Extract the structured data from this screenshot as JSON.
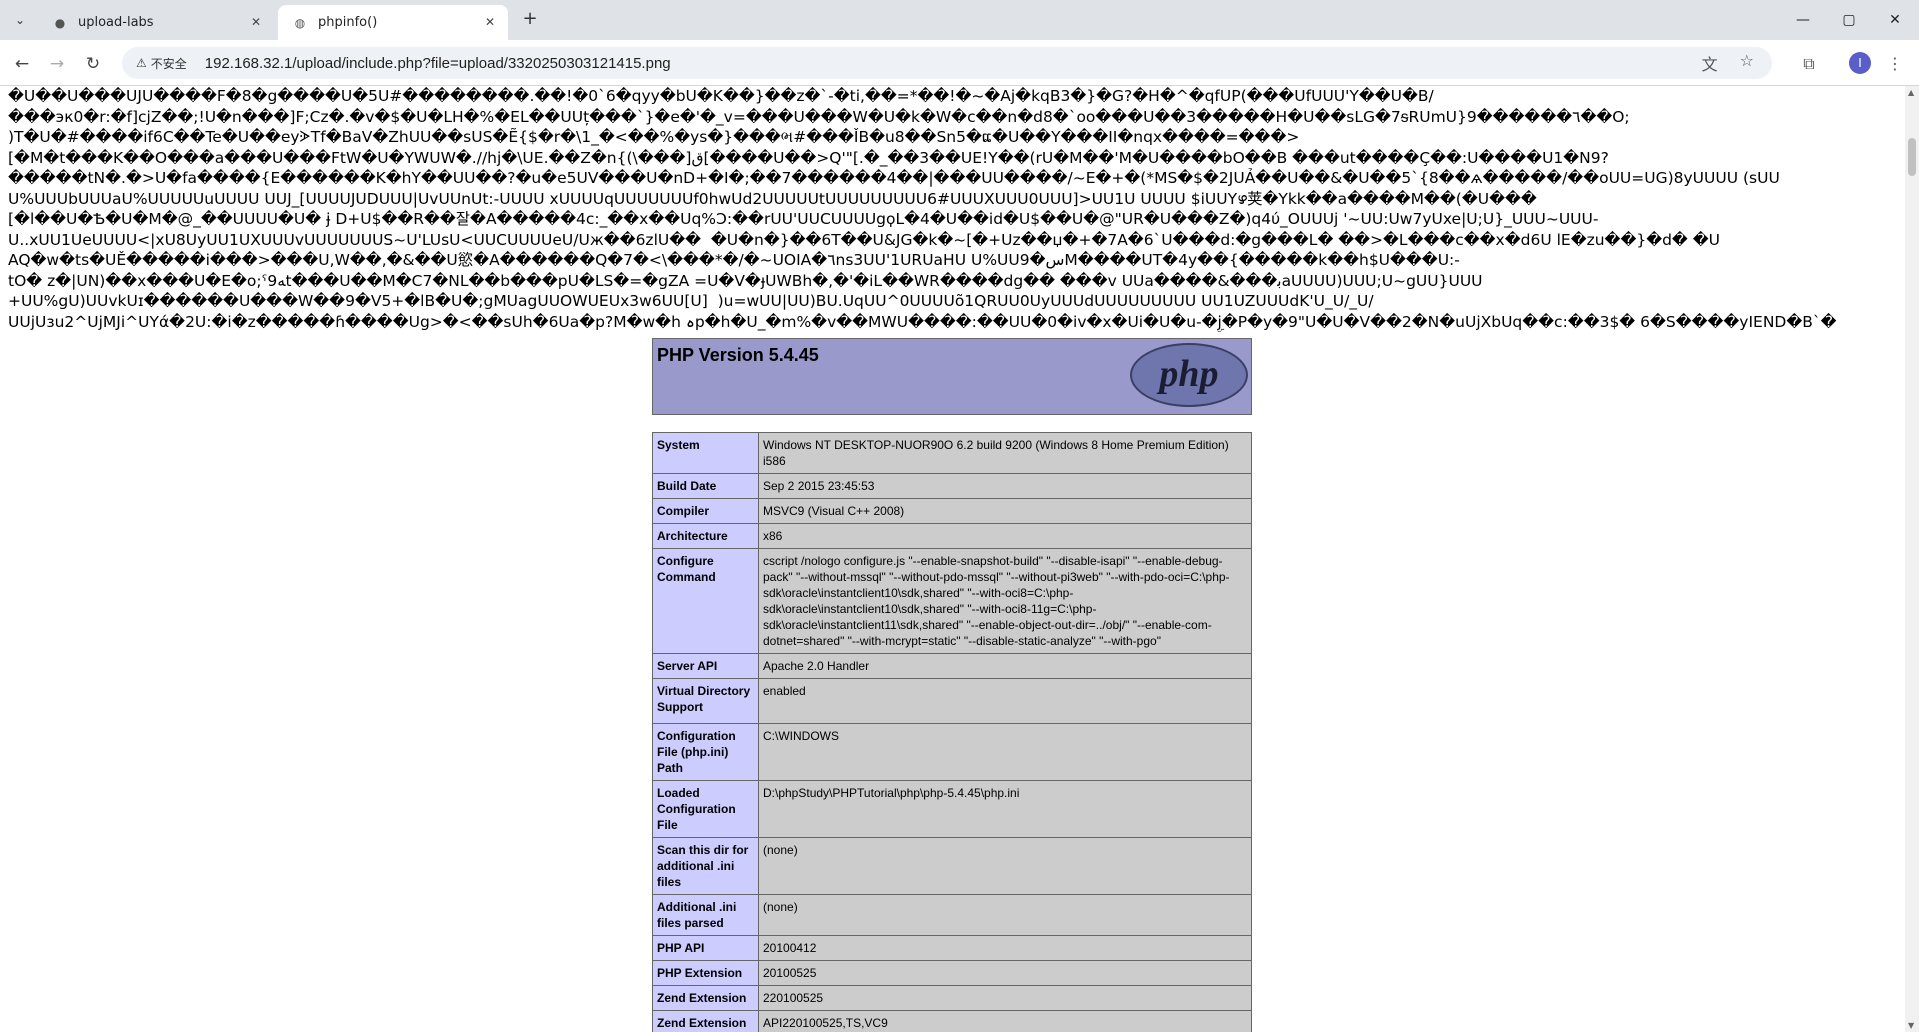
{
  "tabs": [
    {
      "title": "upload-labs",
      "icon": "github-icon",
      "active": false
    },
    {
      "title": "phpinfo()",
      "icon": "globe-icon",
      "active": true
    }
  ],
  "window_controls": [
    "—",
    "▢",
    "✕"
  ],
  "address_bar": {
    "security_label": "不安全",
    "url": "192.168.32.1/upload/include.php?file=upload/3320250303121415.png"
  },
  "garbage_lines": [
    "�U��U���UJU����F�8�g����U�5U#��������.��!�0`6�qyy�bU�K��}��z�`-�ti,��=*��!�~�Aj�kqB3�}�G?�H�^�qfUP(���UfUUU'Y��U�B/",
    "���эк0�r:�f]cjZ��;!U�n���]F;Cz�.�v�$�U�LH�%�EL��UUț���`}�e�'�_v=���U���W�U�k�W�c��n�d8�`oo���U��3�����H�U��sLG�7ᵴRUmU}9������٦��O;",
    ")T�U�#����if6C��Te�U��eyᗈTf�BaV�ZhUU��sUS�Ẽ{$�r�\\1_�<��%�ys�}���ભ#���ǏB�u8��Sn5�ແ�U��Y���II�nqx����=���>",
    "[�M�t���K��O���a���U���FtW�U�YWUW�.//hj�\\UE.��Z�n{(\\���]ق[����U��>Q'\"[.�_��3��UE!Y��(rU�M��'M�U����bO��B ���ut����Ç��:U����U1�N9?",
    "�����tN�.�>U�fa����{E������K�hY��UU��?�u�e5UV���U�nD+�I�;��7������4��|���UU����/~E�+�(*MS�$�2JUẢ��U��&�U��5`{8��ѧ�����/��oUU=UG)8yUUUU (sUU",
    "U%UUUbUUUaU%UUUUUuUUUU UUJ_[UUUUJUDUUU|UvUUnUt:-UUUU xUUUUqUUUUUUUf0hwUd2UUUUUtUUUUUUUUU6#UUUXUUU0UUU]>UU1U UUUU $iUUYഴ荚�Ykk��a����M��(�U���",
    "[�l��U�Ѣ�U�M�@_��UUUU�U� ɉ D+U$��R��잘�A�����4c:_��x��Uq%Ͻ:��rUU'UUCUUUUgϙL�4�U��id�U$��U�@\"UR�U���Z�)q4ύ_OUUUj '~UU:Uw7yUxe|U;U}_UUU~UUU-",
    "U..xUU1UeUUUU<|xU8UyUU1UXUUUvUUUUUUUS~U'LUsU<UUCUUUUeU/Uж��6zlU��  �U�n�}��6T��U&JG�k�~[�+Uz��џ�+�7A�6`U���d:�g���L� ��>�L���c��x�d6U lE�zu��}�d� �U",
    "AQ�w�ts�UĚ�����i���>���U,W��,�&��U慾�A������Q�7�<\\���*�/�~UOIA�٦ns3UU'1URUaHU U%UU9�ﺱM����UT�4y��{�����k��h$U���U:-",
    "tO� z�|UN)��x���U�E�o;ˁ9ﻪt���U��M�C7�NL��b���pU�LS�=�gZA =U�V�ɟUWBh�,�'�iL��WR����dg�� ���v UUa����&���ﺑaUUUU)UUU;U~gUU}UUU",
    "+UU%gU)UUvkUɪ������U���W��9�V5+�lB�U�;gMUagUUOWUEUx3w6UU[U]  )u=wUU|UU)BU.UqUU^0UUUUõ1QRUU0UyUUUdUUUUUUUUU UU1UZUUUdK'U_U/_U/",
    "UUjUзu2^UjMJi^UYά�2U:�i�z�����ɦ����Ug>�<��sUh�6Ua�p?M�w�h ہp�h�U_�m%�v��MWU����:��UU�0�iv�x�Ui�U�u-�ۣj�P�y�9\"U�U�V��2�N�uUjXbUq��c:��3$� 6�S����yIEND�B`�"
  ],
  "php": {
    "version_title": "PHP Version 5.4.45",
    "logo_text": "php",
    "rows": [
      {
        "key": "System",
        "value": "Windows NT DESKTOP-NUOR90O 6.2 build 9200 (Windows 8 Home Premium Edition) i586"
      },
      {
        "key": "Build Date",
        "value": "Sep 2 2015 23:45:53"
      },
      {
        "key": "Compiler",
        "value": "MSVC9 (Visual C++ 2008)"
      },
      {
        "key": "Architecture",
        "value": "x86"
      },
      {
        "key": "Configure Command",
        "value": "cscript /nologo configure.js \"--enable-snapshot-build\" \"--disable-isapi\" \"--enable-debug-pack\" \"--without-mssql\" \"--without-pdo-mssql\" \"--without-pi3web\" \"--with-pdo-oci=C:\\php-sdk\\oracle\\instantclient10\\sdk,shared\" \"--with-oci8=C:\\php-sdk\\oracle\\instantclient10\\sdk,shared\" \"--with-oci8-11g=C:\\php-sdk\\oracle\\instantclient11\\sdk,shared\" \"--enable-object-out-dir=../obj/\" \"--enable-com-dotnet=shared\" \"--with-mcrypt=static\" \"--disable-static-analyze\" \"--with-pgo\""
      },
      {
        "key": "Server API",
        "value": "Apache 2.0 Handler"
      },
      {
        "key": "Virtual Directory Support",
        "value": "enabled"
      },
      {
        "key": "Configuration File (php.ini) Path",
        "value": "C:\\WINDOWS"
      },
      {
        "key": "Loaded Configuration File",
        "value": "D:\\phpStudy\\PHPTutorial\\php\\php-5.4.45\\php.ini"
      },
      {
        "key": "Scan this dir for additional .ini files",
        "value": "(none)"
      },
      {
        "key": "Additional .ini files parsed",
        "value": "(none)"
      },
      {
        "key": "PHP API",
        "value": "20100412"
      },
      {
        "key": "PHP Extension",
        "value": "20100525"
      },
      {
        "key": "Zend Extension",
        "value": "220100525"
      },
      {
        "key": "Zend Extension Build",
        "value": "API220100525,TS,VC9"
      }
    ]
  }
}
